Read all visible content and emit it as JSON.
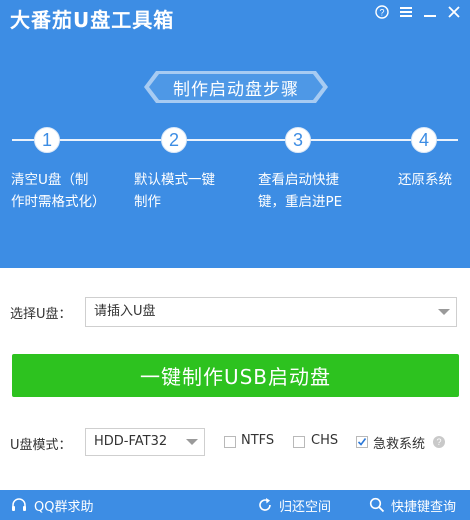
{
  "app": {
    "title": "大番茄U盘工具箱"
  },
  "window": {
    "help": "?",
    "menu": "≡",
    "minimize": "—",
    "close": "✕"
  },
  "banner": {
    "title": "制作启动盘步骤"
  },
  "steps": [
    {
      "num": "1",
      "text": "清空U盘（制\n作时需格式化）"
    },
    {
      "num": "2",
      "text": "默认模式一键\n制作"
    },
    {
      "num": "3",
      "text": "查看启动快捷\n键，重启进PE"
    },
    {
      "num": "4",
      "text": "还原系统"
    }
  ],
  "usb_select": {
    "label": "选择U盘：",
    "value": "请插入U盘"
  },
  "make_button": {
    "label": "一键制作USB启动盘"
  },
  "mode": {
    "label": "U盘模式：",
    "value": "HDD-FAT32"
  },
  "options": [
    {
      "label": "NTFS",
      "checked": false
    },
    {
      "label": "CHS",
      "checked": false
    },
    {
      "label": "急救系统",
      "checked": true
    }
  ],
  "help_icon": "?",
  "footer": {
    "qq": "QQ群求助",
    "restore": "归还空间",
    "shortcut": "快捷键查询"
  },
  "colors": {
    "primary": "#3d8de4",
    "button": "#2dc21f"
  }
}
